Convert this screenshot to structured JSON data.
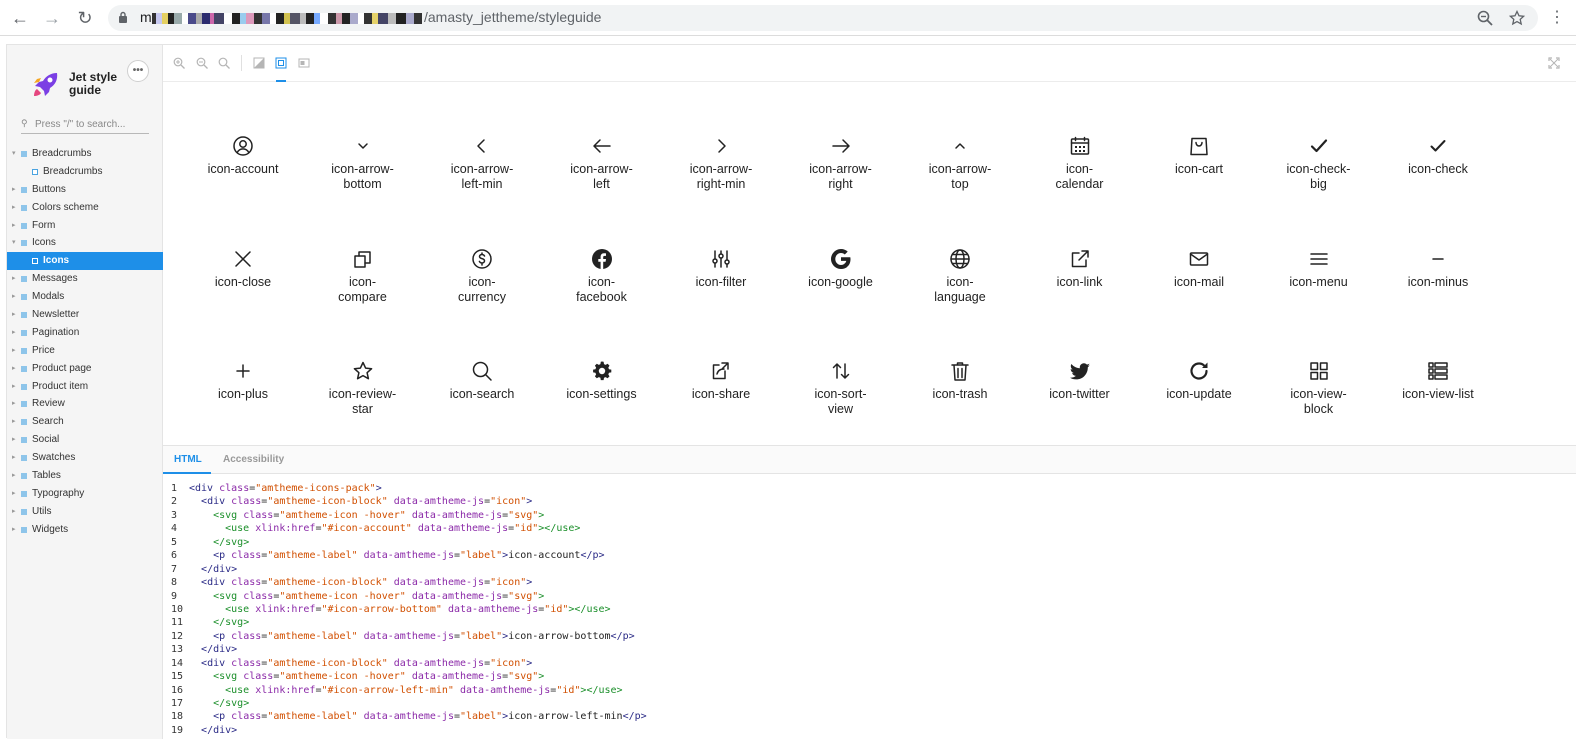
{
  "browser": {
    "url_visible": "/amasty_jettheme/styleguide",
    "url_prefix": "m"
  },
  "sidebar": {
    "logo_text": "Jet style guide",
    "more_label": "•••",
    "search_placeholder": "Press \"/\" to search...",
    "items": [
      {
        "label": "Breadcrumbs",
        "level": 0,
        "expanded": true
      },
      {
        "label": "Breadcrumbs",
        "level": 1
      },
      {
        "label": "Buttons",
        "level": 0
      },
      {
        "label": "Colors scheme",
        "level": 0
      },
      {
        "label": "Form",
        "level": 0
      },
      {
        "label": "Icons",
        "level": 0,
        "expanded": true
      },
      {
        "label": "Icons",
        "level": 1,
        "active": true
      },
      {
        "label": "Messages",
        "level": 0
      },
      {
        "label": "Modals",
        "level": 0
      },
      {
        "label": "Newsletter",
        "level": 0
      },
      {
        "label": "Pagination",
        "level": 0
      },
      {
        "label": "Price",
        "level": 0
      },
      {
        "label": "Product page",
        "level": 0
      },
      {
        "label": "Product item",
        "level": 0
      },
      {
        "label": "Review",
        "level": 0
      },
      {
        "label": "Search",
        "level": 0
      },
      {
        "label": "Social",
        "level": 0
      },
      {
        "label": "Swatches",
        "level": 0
      },
      {
        "label": "Tables",
        "level": 0
      },
      {
        "label": "Typography",
        "level": 0
      },
      {
        "label": "Utils",
        "level": 0
      },
      {
        "label": "Widgets",
        "level": 0
      }
    ]
  },
  "icons": [
    [
      "icon-account",
      "icon-arrow-",
      "bottom"
    ],
    [
      "icon-arrow-bottom",
      "icon-arrow-",
      "left-min"
    ]
  ],
  "icon_labels": [
    {
      "name": "account-icon",
      "l1": "icon-account",
      "l2": ""
    },
    {
      "name": "arrow-bottom-icon",
      "l1": "icon-arrow-",
      "l2": "bottom"
    },
    {
      "name": "arrow-left-min-icon",
      "l1": "icon-arrow-",
      "l2": "left-min"
    },
    {
      "name": "arrow-left-icon",
      "l1": "icon-arrow-",
      "l2": "left"
    },
    {
      "name": "arrow-right-min-icon",
      "l1": "icon-arrow-",
      "l2": "right-min"
    },
    {
      "name": "arrow-right-icon",
      "l1": "icon-arrow-",
      "l2": "right"
    },
    {
      "name": "arrow-top-icon",
      "l1": "icon-arrow-",
      "l2": "top"
    },
    {
      "name": "calendar-icon",
      "l1": "icon-",
      "l2": "calendar"
    },
    {
      "name": "cart-icon",
      "l1": "icon-cart",
      "l2": ""
    },
    {
      "name": "check-big-icon",
      "l1": "icon-check-",
      "l2": "big"
    },
    {
      "name": "check-icon",
      "l1": "icon-check",
      "l2": ""
    },
    {
      "name": "close-icon",
      "l1": "icon-close",
      "l2": ""
    },
    {
      "name": "compare-icon",
      "l1": "icon-",
      "l2": "compare"
    },
    {
      "name": "currency-icon",
      "l1": "icon-",
      "l2": "currency"
    },
    {
      "name": "facebook-icon",
      "l1": "icon-",
      "l2": "facebook"
    },
    {
      "name": "filter-icon",
      "l1": "icon-filter",
      "l2": ""
    },
    {
      "name": "google-icon",
      "l1": "icon-google",
      "l2": ""
    },
    {
      "name": "language-icon",
      "l1": "icon-",
      "l2": "language"
    },
    {
      "name": "link-icon",
      "l1": "icon-link",
      "l2": ""
    },
    {
      "name": "mail-icon",
      "l1": "icon-mail",
      "l2": ""
    },
    {
      "name": "menu-icon",
      "l1": "icon-menu",
      "l2": ""
    },
    {
      "name": "minus-icon",
      "l1": "icon-minus",
      "l2": ""
    },
    {
      "name": "plus-icon",
      "l1": "icon-plus",
      "l2": ""
    },
    {
      "name": "review-star-icon",
      "l1": "icon-review-",
      "l2": "star"
    },
    {
      "name": "search-icon",
      "l1": "icon-search",
      "l2": ""
    },
    {
      "name": "settings-icon",
      "l1": "icon-settings",
      "l2": ""
    },
    {
      "name": "share-icon",
      "l1": "icon-share",
      "l2": ""
    },
    {
      "name": "sort-view-icon",
      "l1": "icon-sort-",
      "l2": "view"
    },
    {
      "name": "trash-icon",
      "l1": "icon-trash",
      "l2": ""
    },
    {
      "name": "twitter-icon",
      "l1": "icon-twitter",
      "l2": ""
    },
    {
      "name": "update-icon",
      "l1": "icon-update",
      "l2": ""
    },
    {
      "name": "view-block-icon",
      "l1": "icon-view-",
      "l2": "block"
    },
    {
      "name": "view-list-icon",
      "l1": "icon-view-list",
      "l2": ""
    }
  ],
  "panel_tabs": [
    "HTML",
    "Accessibility"
  ],
  "code_lines": [
    {
      "n": "1",
      "indent": 0,
      "kind": "open_div",
      "cls": "amtheme-icons-pack"
    },
    {
      "n": "2",
      "indent": 1,
      "kind": "open_div_js",
      "cls": "amtheme-icon-block",
      "js": "icon"
    },
    {
      "n": "3",
      "indent": 2,
      "kind": "open_svg",
      "cls": "amtheme-icon -hover",
      "js": "svg"
    },
    {
      "n": "4",
      "indent": 3,
      "kind": "use",
      "href": "#icon-account",
      "js": "id"
    },
    {
      "n": "5",
      "indent": 2,
      "kind": "close",
      "tag": "svg"
    },
    {
      "n": "6",
      "indent": 2,
      "kind": "p",
      "cls": "amtheme-label",
      "js": "label",
      "text": "icon-account"
    },
    {
      "n": "7",
      "indent": 1,
      "kind": "close",
      "tag": "div"
    },
    {
      "n": "8",
      "indent": 1,
      "kind": "open_div_js",
      "cls": "amtheme-icon-block",
      "js": "icon"
    },
    {
      "n": "9",
      "indent": 2,
      "kind": "open_svg",
      "cls": "amtheme-icon -hover",
      "js": "svg"
    },
    {
      "n": "10",
      "indent": 3,
      "kind": "use",
      "href": "#icon-arrow-bottom",
      "js": "id"
    },
    {
      "n": "11",
      "indent": 2,
      "kind": "close",
      "tag": "svg"
    },
    {
      "n": "12",
      "indent": 2,
      "kind": "p",
      "cls": "amtheme-label",
      "js": "label",
      "text": "icon-arrow-bottom"
    },
    {
      "n": "13",
      "indent": 1,
      "kind": "close",
      "tag": "div"
    },
    {
      "n": "14",
      "indent": 1,
      "kind": "open_div_js",
      "cls": "amtheme-icon-block",
      "js": "icon"
    },
    {
      "n": "15",
      "indent": 2,
      "kind": "open_svg",
      "cls": "amtheme-icon -hover",
      "js": "svg"
    },
    {
      "n": "16",
      "indent": 3,
      "kind": "use",
      "href": "#icon-arrow-left-min",
      "js": "id"
    },
    {
      "n": "17",
      "indent": 2,
      "kind": "close",
      "tag": "svg"
    },
    {
      "n": "18",
      "indent": 2,
      "kind": "p",
      "cls": "amtheme-label",
      "js": "label",
      "text": "icon-arrow-left-min"
    },
    {
      "n": "19",
      "indent": 1,
      "kind": "close",
      "tag": "div"
    }
  ],
  "colors": {
    "accent": "#1e8fe8",
    "sidebar_bg": "#f5f5f5"
  }
}
